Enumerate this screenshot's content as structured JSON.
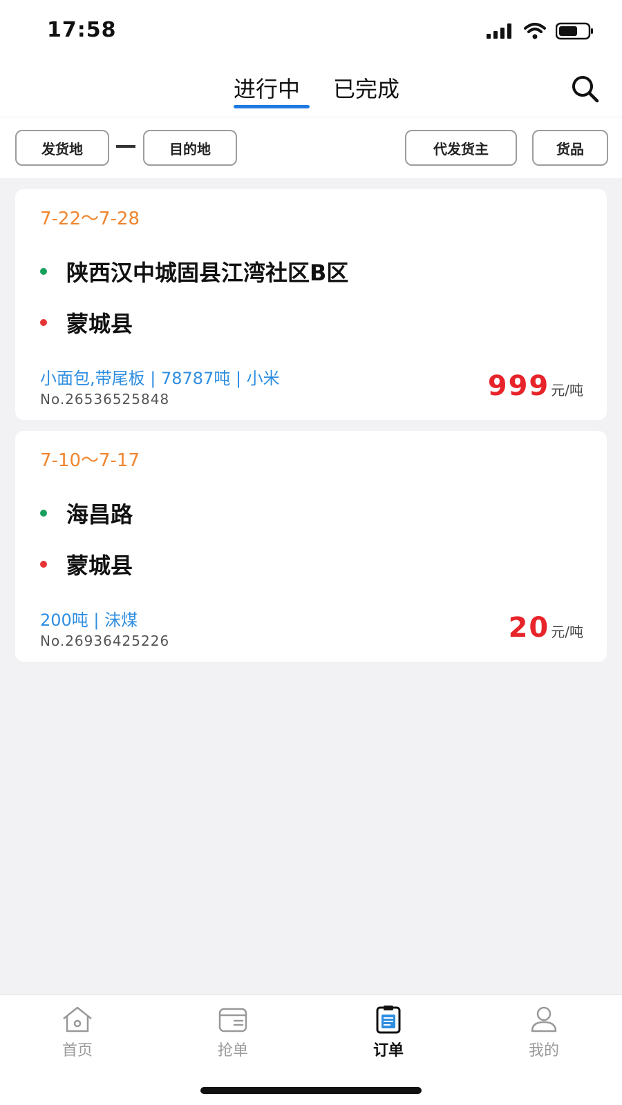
{
  "status_bar": {
    "time": "17:58"
  },
  "tabs": [
    {
      "label": "进行中",
      "active": true
    },
    {
      "label": "已完成",
      "active": false
    }
  ],
  "filters": {
    "origin": "发货地",
    "destination": "目的地",
    "shipper": "代发货主",
    "goods": "货品"
  },
  "orders": [
    {
      "date_range": "7-22～7-28",
      "from": "陕西汉中城固县江湾社区B区",
      "to": "蒙城县",
      "info": "小面包,带尾板 | 78787吨 | 小米",
      "order_no": "No.26536525848",
      "price": "999",
      "unit": "元/吨"
    },
    {
      "date_range": "7-10～7-17",
      "from": "海昌路",
      "to": "蒙城县",
      "info": "200吨 | 沫煤",
      "order_no": "No.26936425226",
      "price": "20",
      "unit": "元/吨"
    }
  ],
  "bottom_nav": [
    {
      "label": "首页",
      "icon": "home-icon",
      "active": false
    },
    {
      "label": "抢单",
      "icon": "wallet-icon",
      "active": false
    },
    {
      "label": "订单",
      "icon": "clipboard-icon",
      "active": true
    },
    {
      "label": "我的",
      "icon": "user-icon",
      "active": false
    }
  ],
  "colors": {
    "accent": "#1e7ae0",
    "date": "#f0852e",
    "price": "#e8242b",
    "info": "#2f8ee0",
    "from_dot": "#17a05d",
    "to_dot": "#e63434"
  }
}
